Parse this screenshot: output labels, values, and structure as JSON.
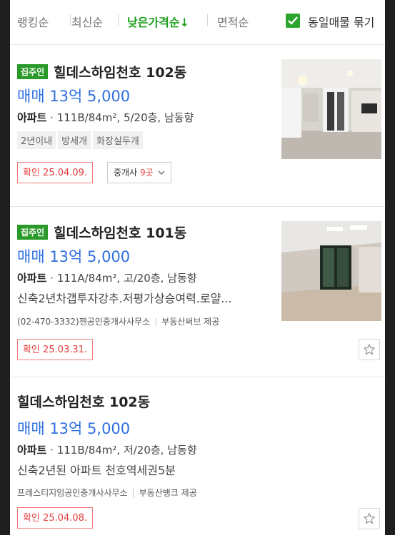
{
  "sort": {
    "items": [
      {
        "label": "랭킹순",
        "active": false
      },
      {
        "label": "최신순",
        "active": false
      },
      {
        "label": "낮은가격순↓",
        "active": true
      },
      {
        "label": "면적순",
        "active": false
      }
    ],
    "group_label": "동일매물 묶기"
  },
  "listings": [
    {
      "badge": "집주인",
      "title": "힐데스하임천호 102동",
      "price": "매매 13억 5,000",
      "type": "아파트",
      "spec": "111B/84m², 5/20층, 남동향",
      "tags": [
        "2년이내",
        "방세개",
        "화장실두개"
      ],
      "verified": "확인 25.04.09.",
      "agency_label": "중개사 ",
      "agency_count": "9곳"
    },
    {
      "badge": "집주인",
      "title": "힐데스하임천호 101동",
      "price": "매매 13억 5,000",
      "type": "아파트",
      "spec": "111A/84m², 고/20층, 남동향",
      "desc": "신축2년차갭투자강추.저평가상승여력.로얄...",
      "agency": "(02-470-3332)젠공인중개사사무소",
      "provider": "부동산써브 제공",
      "verified": "확인 25.03.31."
    },
    {
      "title": "힐데스하임천호 102동",
      "price": "매매 13억 5,000",
      "type": "아파트",
      "spec": "111B/84m², 저/20층, 남동향",
      "desc": "신축2년된 아파트 천호역세권5분",
      "agency": "프레스티지임공인중개사사무소",
      "provider": "부동산뱅크 제공",
      "verified": "확인 25.04.08."
    }
  ],
  "colors": {
    "accent": "#1ea01e",
    "price": "#2f6fe0",
    "verify": "#e43c3c"
  }
}
